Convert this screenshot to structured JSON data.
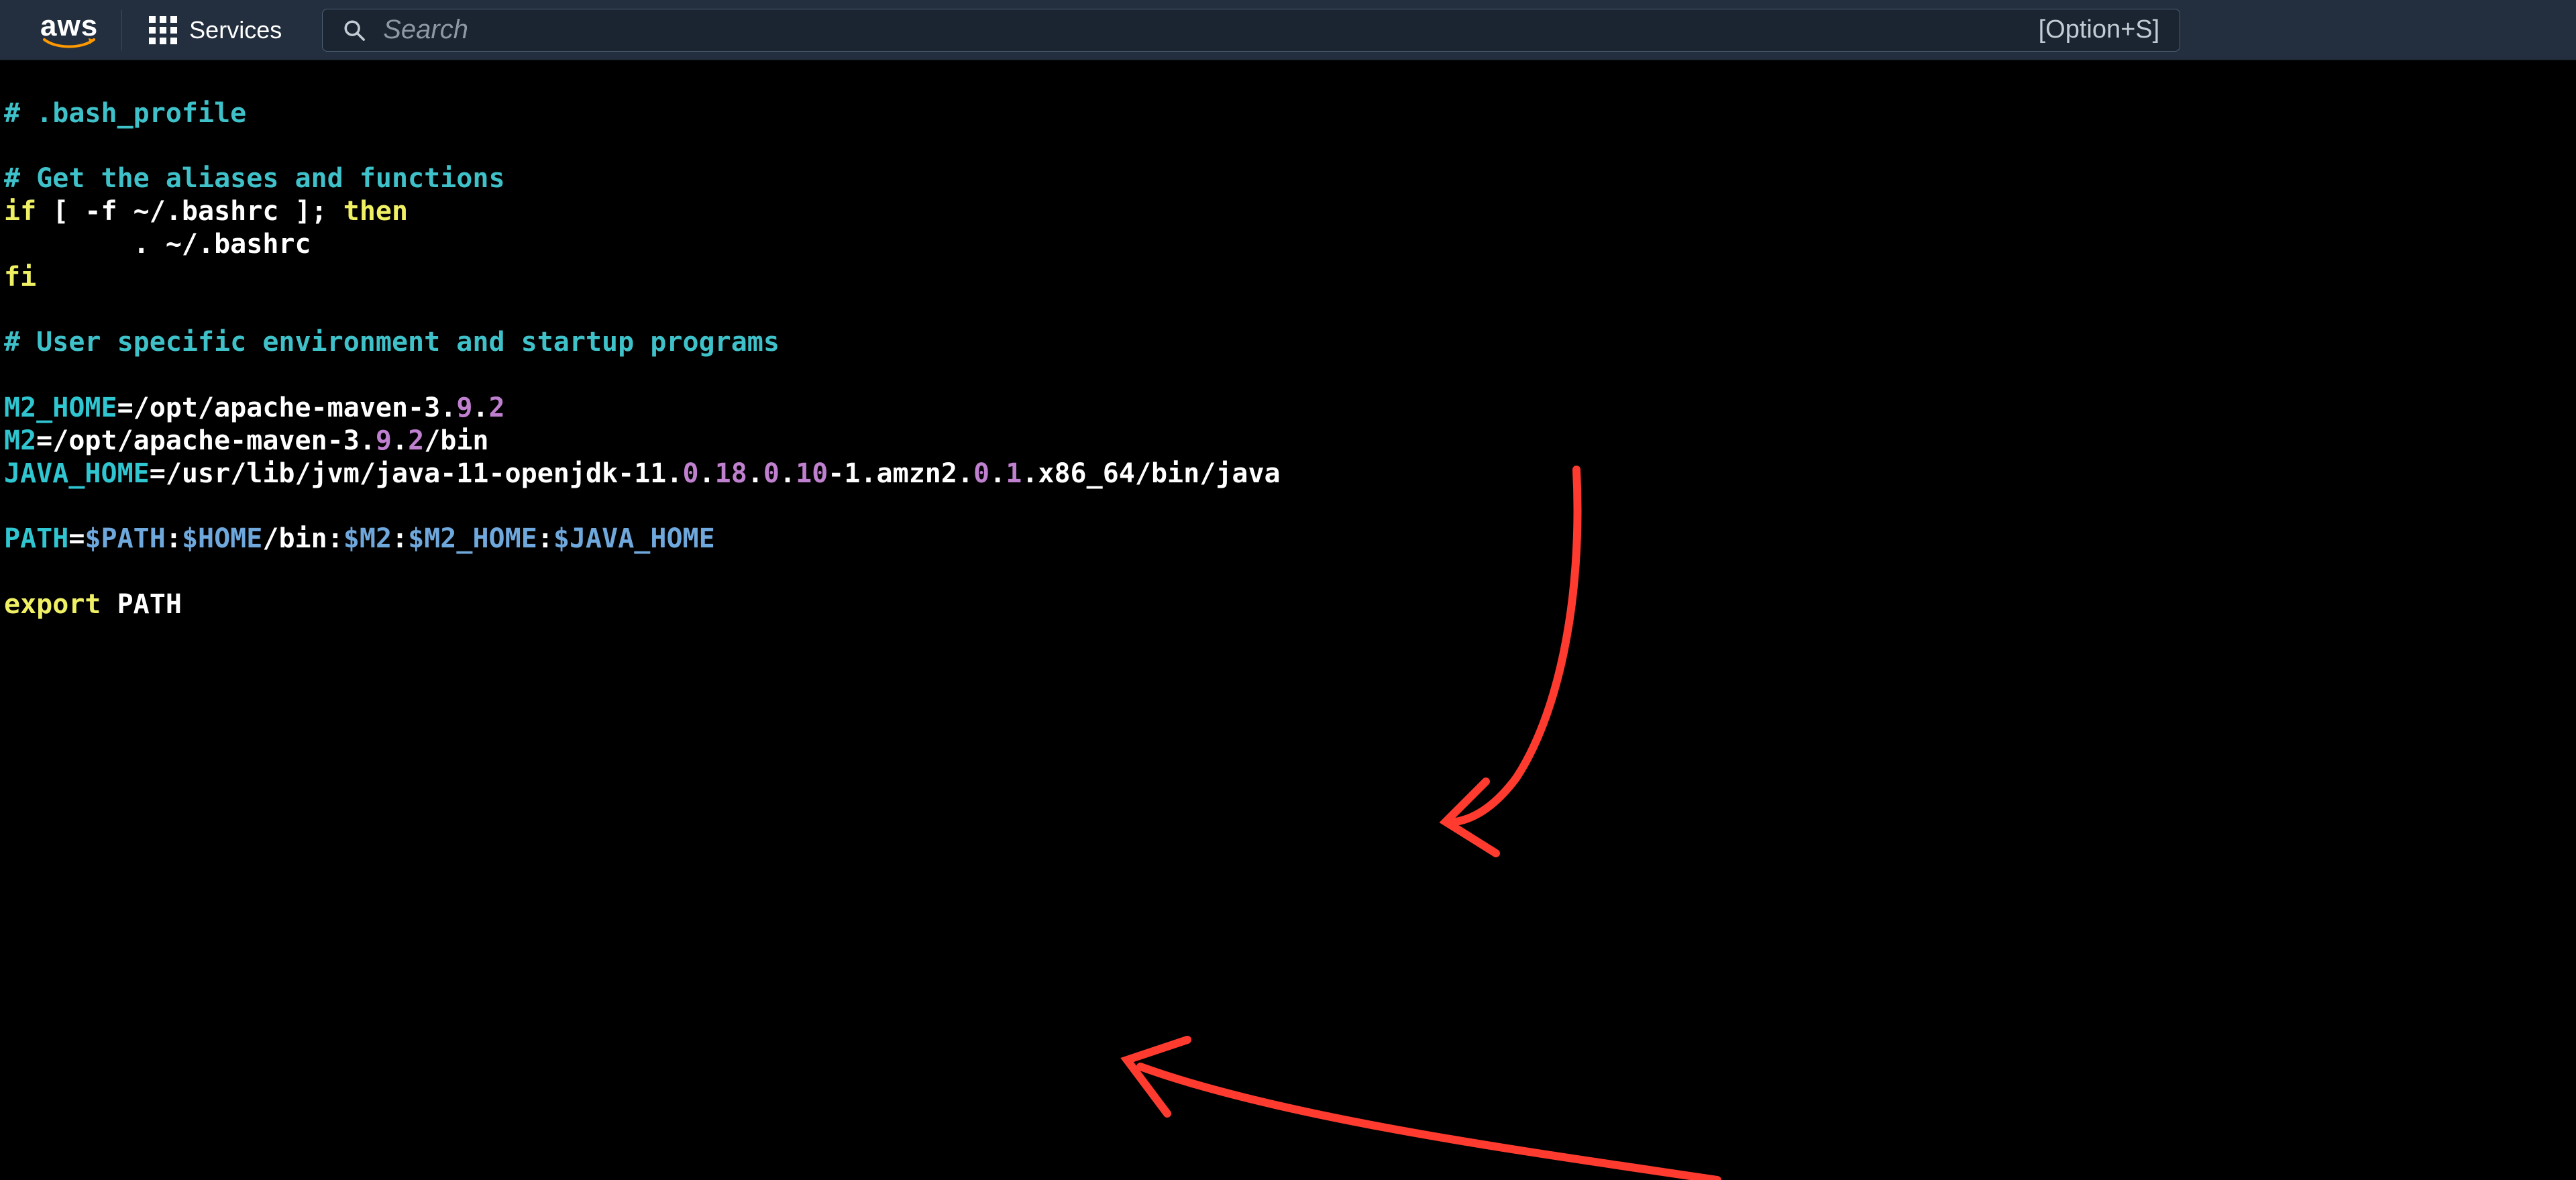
{
  "header": {
    "logo_text": "aws",
    "services_label": "Services",
    "search_placeholder": "Search",
    "search_hint": "[Option+S]"
  },
  "code": {
    "comment_profile": "# .bash_profile",
    "comment_aliases": "# Get the aliases and functions",
    "if_kw": "if",
    "if_cond": " [ -f ~/.bashrc ]; ",
    "then_kw": "then",
    "source_line": "        . ~/.bashrc",
    "fi_kw": "fi",
    "comment_env": "# User specific environment and startup programs",
    "m2home_var": "M2_HOME",
    "m2home_pre": "=/opt/apache-maven-3.",
    "m2home_n1": "9",
    "m2home_mid": ".",
    "m2home_n2": "2",
    "m2_var": "M2",
    "m2_pre": "=/opt/apache-maven-3.",
    "m2_n1": "9",
    "m2_mid": ".",
    "m2_n2": "2",
    "m2_post": "/bin",
    "java_var": "JAVA_HOME",
    "java_pre": "=/usr/lib/jvm/java-11-openjdk-11.",
    "java_n1": "0",
    "java_s1": ".",
    "java_n2": "18",
    "java_s2": ".",
    "java_n3": "0",
    "java_s3": ".",
    "java_n4": "10",
    "java_mid1": "-1.amzn2.",
    "java_n5": "0",
    "java_s4": ".",
    "java_n6": "1",
    "java_post": ".x86_64/bin/java",
    "path_var": "PATH",
    "eq": "=",
    "path_env1": "$PATH",
    "colon": ":",
    "path_env2": "$HOME",
    "path_bin": "/bin:",
    "path_env3": "$M2",
    "path_env4": "$M2_HOME",
    "path_env5": "$JAVA_HOME",
    "export_kw": "export",
    "export_var": " PATH"
  }
}
